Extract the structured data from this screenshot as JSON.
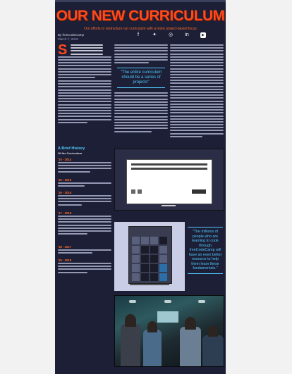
{
  "article": {
    "title": "OUR NEW CURRICULUM",
    "subtitle": "Our efforts to restructure our curriculum with a more project-based focus",
    "author": "By freeCodeCamp",
    "date": "March 7, 2019",
    "dropcap": "S",
    "pull_quote": "\"The entire curriculum should be a series of projects\""
  },
  "social": {
    "icons": [
      "facebook-icon",
      "twitter-icon",
      "instagram-icon",
      "linkedin-icon",
      "youtube-icon"
    ]
  },
  "brief_history": {
    "title": "A Brief History",
    "subtitle": "Of the Curriculum",
    "eras": [
      "'15 - 2014",
      "'15 - 2015",
      "'16 - 2016",
      "'17 - 2018",
      "'18 - 2017",
      "'19 - 2018"
    ]
  },
  "callout": {
    "text": "\"The millions of people who are learning to code through freeCodeCamp will have an even better resource to help them learn these fundamentals.\""
  },
  "colors": {
    "accent_orange": "#ff4a1c",
    "accent_blue": "#52c8ff",
    "background": "#1c1f35"
  }
}
